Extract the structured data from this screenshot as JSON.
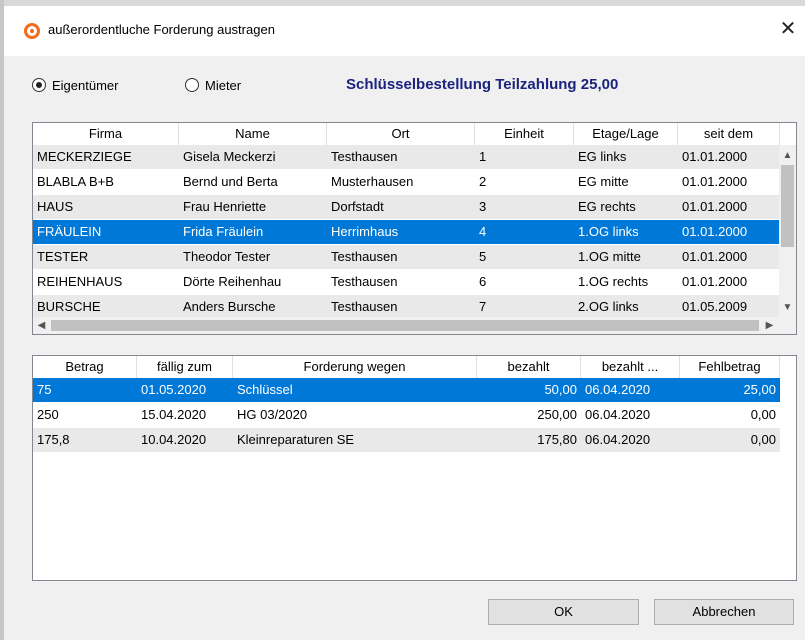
{
  "window": {
    "title": "außerordentluche Forderung austragen",
    "close_symbol": "✕"
  },
  "options": {
    "owner_label": "Eigentümer",
    "tenant_label": "Mieter",
    "selected": "owner"
  },
  "headline": "Schlüsselbestellung Teilzahlung 25,00",
  "owners_table": {
    "columns": [
      "Firma",
      "Name",
      "Ort",
      "Einheit",
      "Etage/Lage",
      "seit dem"
    ],
    "rows": [
      [
        "MECKERZIEGE",
        "Gisela Meckerzi",
        "Testhausen",
        "1",
        "EG links",
        "01.01.2000"
      ],
      [
        "BLABLA B+B",
        "Bernd und Berta",
        "Musterhausen",
        "2",
        "EG mitte",
        "01.01.2000"
      ],
      [
        "HAUS",
        "Frau Henriette",
        "Dorfstadt",
        "3",
        "EG rechts",
        "01.01.2000"
      ],
      [
        "FRÄULEIN",
        "Frida Fräulein",
        "Herrimhaus",
        "4",
        "1.OG links",
        "01.01.2000"
      ],
      [
        "TESTER",
        "Theodor Tester",
        "Testhausen",
        "5",
        "1.OG mitte",
        "01.01.2000"
      ],
      [
        "REIHENHAUS",
        "Dörte Reihenhau",
        "Testhausen",
        "6",
        "1.OG rechts",
        "01.01.2000"
      ],
      [
        "BURSCHE",
        "Anders Bursche",
        "Testhausen",
        "7",
        "2.OG links",
        "01.05.2009"
      ]
    ],
    "selected_row": 3
  },
  "claims_table": {
    "columns": [
      "Betrag",
      "fällig zum",
      "Forderung wegen",
      "bezahlt",
      "bezahlt ...",
      "Fehlbetrag"
    ],
    "rows": [
      [
        "75",
        "01.05.2020",
        "Schlüssel",
        "50,00",
        "06.04.2020",
        "25,00"
      ],
      [
        "250",
        "15.04.2020",
        "HG 03/2020",
        "250,00",
        "06.04.2020",
        "0,00"
      ],
      [
        "175,8",
        "10.04.2020",
        "Kleinreparaturen SE",
        "175,80",
        "06.04.2020",
        "0,00"
      ]
    ],
    "selected_row": 0
  },
  "buttons": {
    "ok": "OK",
    "cancel": "Abbrechen"
  },
  "colors": {
    "selection": "#0078d7",
    "headline": "#1a237e",
    "row_alt": "#e9e9e9"
  }
}
